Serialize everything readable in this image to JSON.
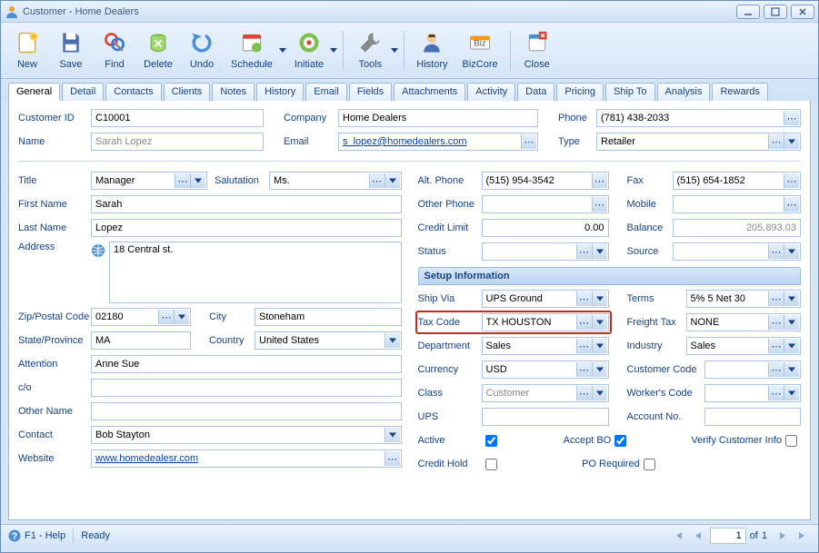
{
  "title": "Customer - Home Dealers",
  "toolbar": [
    {
      "label": "New",
      "icon": "new",
      "dd": false
    },
    {
      "label": "Save",
      "icon": "save",
      "dd": false
    },
    {
      "label": "Find",
      "icon": "find",
      "dd": false
    },
    {
      "label": "Delete",
      "icon": "delete",
      "dd": false
    },
    {
      "label": "Undo",
      "icon": "undo",
      "dd": false
    },
    {
      "label": "Schedule",
      "icon": "schedule",
      "dd": true
    },
    {
      "label": "Initiate",
      "icon": "initiate",
      "dd": true
    },
    {
      "label": "Tools",
      "icon": "tools",
      "dd": true
    },
    {
      "label": "History",
      "icon": "history",
      "dd": false
    },
    {
      "label": "BizCore",
      "icon": "bizcore",
      "dd": false
    },
    {
      "label": "Close",
      "icon": "close",
      "dd": false
    }
  ],
  "tabs": [
    "General",
    "Detail",
    "Contacts",
    "Clients",
    "Notes",
    "History",
    "Email",
    "Fields",
    "Attachments",
    "Activity",
    "Data",
    "Pricing",
    "Ship To",
    "Analysis",
    "Rewards"
  ],
  "active_tab": "General",
  "header": {
    "customer_id_lbl": "Customer ID",
    "customer_id": "C10001",
    "company_lbl": "Company",
    "company": "Home Dealers",
    "phone_lbl": "Phone",
    "phone": "(781) 438-2033",
    "name_lbl": "Name",
    "name": "Sarah Lopez",
    "email_lbl": "Email",
    "email": "s_lopez@homedealers.com",
    "type_lbl": "Type",
    "type": "Retailer"
  },
  "left": {
    "title_lbl": "Title",
    "title": "Manager",
    "salutation_lbl": "Salutation",
    "salutation": "Ms.",
    "first_name_lbl": "First Name",
    "first_name": "Sarah",
    "last_name_lbl": "Last Name",
    "last_name": "Lopez",
    "address_lbl": "Address",
    "address": "18 Central st.",
    "zip_lbl": "Zip/Postal Code",
    "zip": "02180",
    "city_lbl": "City",
    "city": "Stoneham",
    "state_lbl": "State/Province",
    "state": "MA",
    "country_lbl": "Country",
    "country": "United States",
    "attention_lbl": "Attention",
    "attention": "Anne Sue",
    "co_lbl": "c/o",
    "co": "",
    "other_name_lbl": "Other Name",
    "other_name": "",
    "contact_lbl": "Contact",
    "contact": "Bob Stayton",
    "website_lbl": "Website",
    "website": "www.homedealesr.com"
  },
  "right": {
    "alt_phone_lbl": "Alt. Phone",
    "alt_phone": "(515) 954-3542",
    "fax_lbl": "Fax",
    "fax": "(515) 654-1852",
    "other_phone_lbl": "Other Phone",
    "other_phone": "",
    "mobile_lbl": "Mobile",
    "mobile": "",
    "credit_limit_lbl": "Credit Limit",
    "credit_limit": "0.00",
    "balance_lbl": "Balance",
    "balance": "205,893.03",
    "status_lbl": "Status",
    "status": "",
    "source_lbl": "Source",
    "source": ""
  },
  "setup": {
    "heading": "Setup Information",
    "ship_via_lbl": "Ship Via",
    "ship_via": "UPS Ground",
    "terms_lbl": "Terms",
    "terms": "5% 5 Net 30",
    "tax_code_lbl": "Tax Code",
    "tax_code": "TX HOUSTON",
    "freight_tax_lbl": "Freight Tax",
    "freight_tax": "NONE",
    "department_lbl": "Department",
    "department": "Sales",
    "industry_lbl": "Industry",
    "industry": "Sales",
    "currency_lbl": "Currency",
    "currency": "USD",
    "customer_code_lbl": "Customer Code",
    "customer_code": "",
    "class_lbl": "Class",
    "class": "Customer",
    "workers_code_lbl": "Worker's Code",
    "workers_code": "",
    "ups_lbl": "UPS",
    "ups": "",
    "account_no_lbl": "Account No.",
    "account_no": "",
    "active_lbl": "Active",
    "active": true,
    "accept_bo_lbl": "Accept BO",
    "accept_bo": true,
    "verify_lbl": "Verify Customer Info",
    "verify": false,
    "credit_hold_lbl": "Credit Hold",
    "credit_hold": false,
    "po_req_lbl": "PO Required",
    "po_req": false
  },
  "status": {
    "help": "F1 - Help",
    "ready": "Ready",
    "page": "1",
    "of": "of",
    "total": "1"
  }
}
